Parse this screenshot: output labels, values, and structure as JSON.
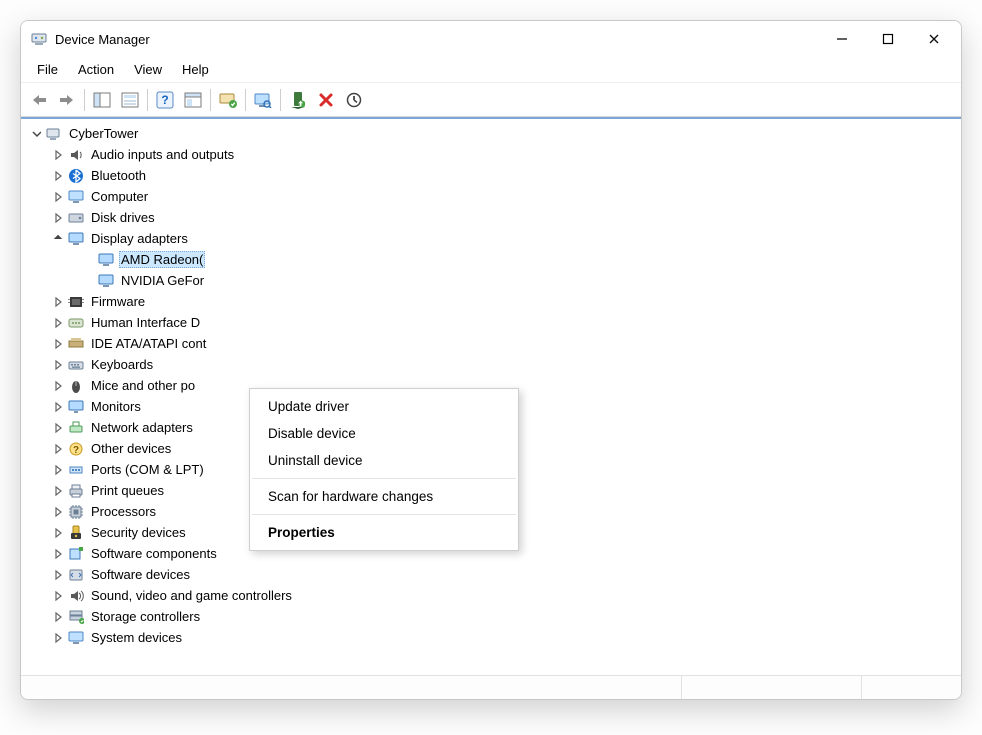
{
  "window": {
    "title": "Device Manager"
  },
  "menubar": {
    "items": [
      "File",
      "Action",
      "View",
      "Help"
    ]
  },
  "toolbar_tooltips": {
    "back": "Back",
    "forward": "Forward",
    "show_hide_tree": "Show/Hide Console Tree",
    "help": "Help",
    "properties": "Properties",
    "scan": "Scan for hardware changes",
    "update_driver": "Update Device Driver",
    "enable": "Enable Device",
    "uninstall": "Uninstall Device",
    "stop": "Stop"
  },
  "tree": {
    "root": {
      "label": "CyberTower"
    },
    "categories": [
      {
        "label": "Audio inputs and outputs",
        "icon": "audio"
      },
      {
        "label": "Bluetooth",
        "icon": "bluetooth"
      },
      {
        "label": "Computer",
        "icon": "computer"
      },
      {
        "label": "Disk drives",
        "icon": "disk"
      },
      {
        "label": "Display adapters",
        "icon": "display",
        "expanded": true,
        "children": [
          {
            "label": "AMD Radeon(",
            "icon": "display",
            "selected": true
          },
          {
            "label": "NVIDIA GeFor",
            "icon": "display"
          }
        ]
      },
      {
        "label": "Firmware",
        "icon": "firmware"
      },
      {
        "label": "Human Interface D",
        "icon": "hid"
      },
      {
        "label": "IDE ATA/ATAPI cont",
        "icon": "ide"
      },
      {
        "label": "Keyboards",
        "icon": "keyboard"
      },
      {
        "label": "Mice and other po",
        "icon": "mouse"
      },
      {
        "label": "Monitors",
        "icon": "monitor"
      },
      {
        "label": "Network adapters",
        "icon": "network"
      },
      {
        "label": "Other devices",
        "icon": "other"
      },
      {
        "label": "Ports (COM & LPT)",
        "icon": "port"
      },
      {
        "label": "Print queues",
        "icon": "printer"
      },
      {
        "label": "Processors",
        "icon": "cpu"
      },
      {
        "label": "Security devices",
        "icon": "security"
      },
      {
        "label": "Software components",
        "icon": "swcomp"
      },
      {
        "label": "Software devices",
        "icon": "swdev"
      },
      {
        "label": "Sound, video and game controllers",
        "icon": "sound"
      },
      {
        "label": "Storage controllers",
        "icon": "storage"
      },
      {
        "label": "System devices",
        "icon": "system"
      }
    ]
  },
  "context_menu": {
    "items": [
      {
        "label": "Update driver"
      },
      {
        "label": "Disable device"
      },
      {
        "label": "Uninstall device"
      },
      {
        "separator": true
      },
      {
        "label": "Scan for hardware changes"
      },
      {
        "separator": true
      },
      {
        "label": "Properties",
        "bold": true
      }
    ]
  }
}
